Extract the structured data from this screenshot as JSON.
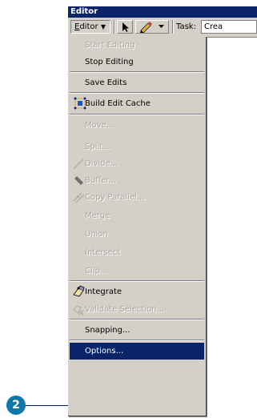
{
  "window": {
    "title": "Editor"
  },
  "toolbar": {
    "editor_label_u": "E",
    "editor_label_rest": "ditor",
    "dropdown_arrow": "▼",
    "task_label": "Task:",
    "task_value": "Crea"
  },
  "menu": {
    "items": [
      {
        "label": "Start Editing",
        "enabled": false
      },
      {
        "label": "Stop Editing",
        "enabled": true
      },
      {
        "label": "Save Edits",
        "enabled": true
      },
      {
        "label": "Build Edit Cache",
        "enabled": true,
        "icon": "build-cache-icon"
      },
      {
        "label": "Move...",
        "enabled": false
      },
      {
        "label": "Split...",
        "enabled": false
      },
      {
        "label": "Divide...",
        "enabled": false,
        "icon": "divide-icon"
      },
      {
        "label": "Buffer...",
        "enabled": false,
        "icon": "buffer-icon"
      },
      {
        "label": "Copy Parallel...",
        "enabled": false,
        "icon": "copy-parallel-icon"
      },
      {
        "label": "Merge",
        "enabled": false
      },
      {
        "label": "Union",
        "enabled": false
      },
      {
        "label": "Intersect",
        "enabled": false
      },
      {
        "label": "Clip...",
        "enabled": false
      },
      {
        "label": "Integrate",
        "enabled": true,
        "icon": "integrate-icon"
      },
      {
        "label": "Validate Selection...",
        "enabled": false,
        "icon": "validate-icon"
      },
      {
        "label": "Snapping...",
        "enabled": true
      },
      {
        "label": "Options...",
        "enabled": true,
        "selected": true
      }
    ]
  },
  "callout": {
    "number": "2"
  },
  "colors": {
    "title_bar": "#0a246a",
    "highlight": "#0a246a",
    "menu_bg": "#d4d0c8",
    "callout": "#0d78a9"
  }
}
